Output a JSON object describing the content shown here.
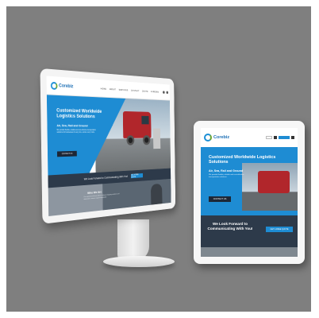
{
  "site": {
    "logo_text": "Corebiz",
    "nav": [
      "HOME",
      "ABOUT",
      "SERVICES",
      "CONTACT",
      "QUOTE",
      "CAREERS"
    ],
    "hero_title": "Customized Worldwide Logistics Solutions",
    "hero_subtitle": "Air, Sea, Rail and Ground",
    "hero_body": "We provide flexible, reliable and cost-effective transportation solutions for businesses of every size, across every mode.",
    "hero_button": "CONTACT US",
    "cta_text": "We Look Forward to Communicating With You!",
    "cta_button": "GET A FREE QUOTE",
    "who_title": "Who We Are",
    "who_text": "Our experienced team delivers tailored shipping solutions and dedicated customer support worldwide."
  },
  "tablet": {
    "logo_text": "Corebiz",
    "hero_title": "Customized Worldwide Logistics Solutions",
    "hero_subtitle": "Air, Sea, Rail and Ground",
    "hero_body": "We provide flexible, reliable and cost-effective transportation solutions.",
    "hero_button": "CONTACT US",
    "cta_text": "We Look Forward to Communicating With You!",
    "cta_button": "GET A FREE QUOTE"
  },
  "colors": {
    "background": "#7f7f7f",
    "brand_blue": "#1e8cd3",
    "dark_navy": "#2d3a4a",
    "truck_red": "#b1262b"
  }
}
